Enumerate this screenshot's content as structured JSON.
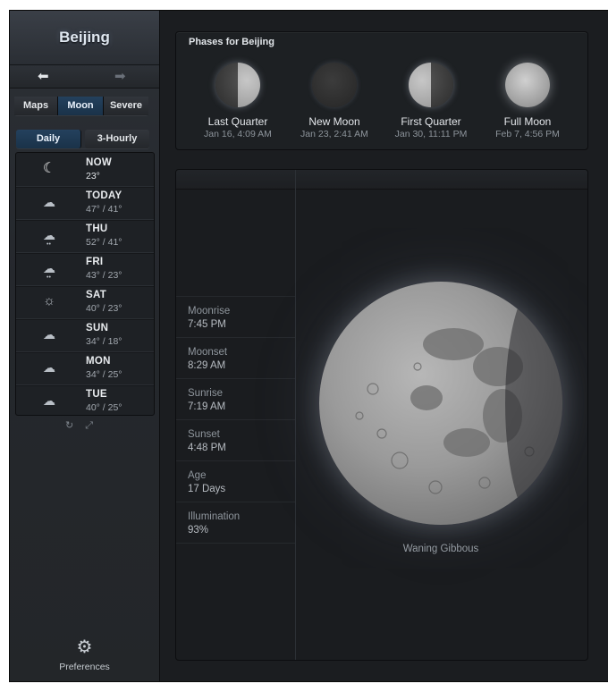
{
  "city": "Beijing",
  "nav": {
    "back_icon": "arrow-left",
    "forward_icon": "arrow-right"
  },
  "view_tabs": [
    {
      "label": "Maps",
      "active": false
    },
    {
      "label": "Moon",
      "active": true
    },
    {
      "label": "Severe",
      "active": false
    }
  ],
  "range_tabs": [
    {
      "label": "Daily",
      "active": true
    },
    {
      "label": "3-Hourly",
      "active": false
    }
  ],
  "forecast": [
    {
      "day": "NOW",
      "temp": "23°",
      "icon": "crescent-moon"
    },
    {
      "day": "TODAY",
      "temp": "47° / 41°",
      "icon": "cloud"
    },
    {
      "day": "THU",
      "temp": "52° / 41°",
      "icon": "cloud-rain"
    },
    {
      "day": "FRI",
      "temp": "43° / 23°",
      "icon": "cloud-rain"
    },
    {
      "day": "SAT",
      "temp": "40° / 23°",
      "icon": "sun"
    },
    {
      "day": "SUN",
      "temp": "34° / 18°",
      "icon": "cloud"
    },
    {
      "day": "MON",
      "temp": "34° / 25°",
      "icon": "cloud"
    },
    {
      "day": "TUE",
      "temp": "40° / 25°",
      "icon": "cloud"
    }
  ],
  "footer_icons": [
    "refresh-icon",
    "expand-icon"
  ],
  "preferences_label": "Preferences",
  "phases": {
    "title": "Phases for Beijing",
    "items": [
      {
        "name": "Last Quarter",
        "date": "Jan 16, 4:09 AM"
      },
      {
        "name": "New Moon",
        "date": "Jan 23, 2:41 AM"
      },
      {
        "name": "First Quarter",
        "date": "Jan 30, 11:11 PM"
      },
      {
        "name": "Full Moon",
        "date": "Feb 7, 4:56 PM"
      }
    ]
  },
  "moon_details": [
    {
      "label": "Moonrise",
      "value": "7:45 PM"
    },
    {
      "label": "Moonset",
      "value": "8:29 AM"
    },
    {
      "label": "Sunrise",
      "value": "7:19 AM"
    },
    {
      "label": "Sunset",
      "value": "4:48 PM"
    },
    {
      "label": "Age",
      "value": "17 Days"
    },
    {
      "label": "Illumination",
      "value": "93%"
    }
  ],
  "current_phase": "Waning Gibbous"
}
